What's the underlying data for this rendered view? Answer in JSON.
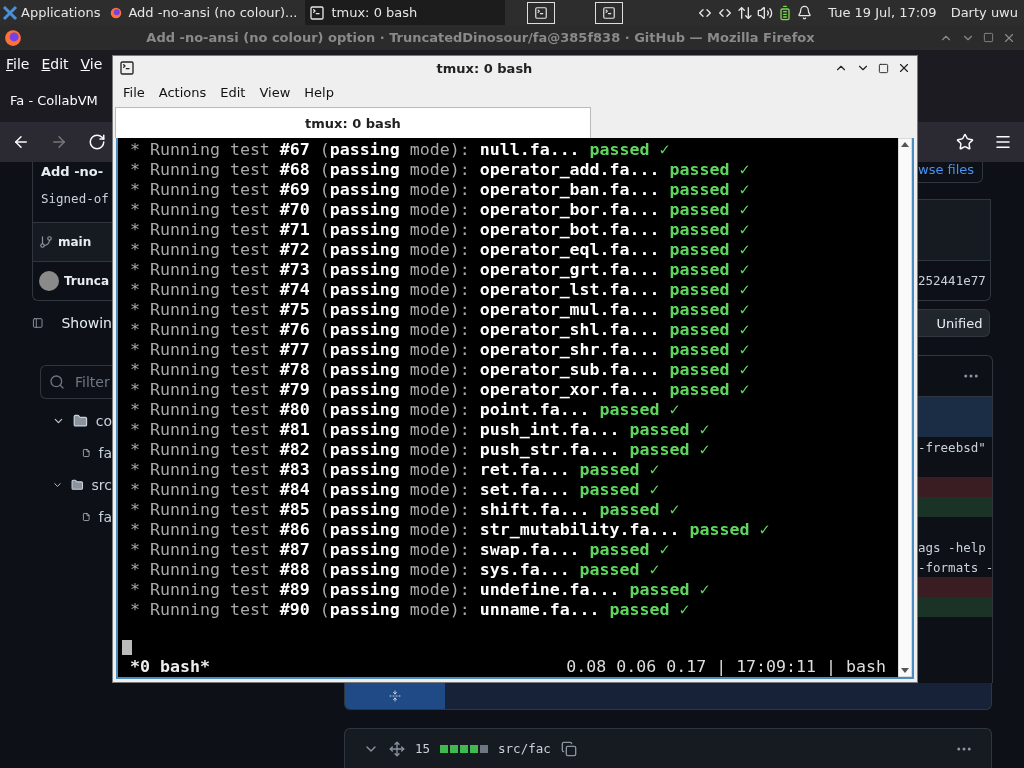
{
  "taskbar": {
    "apps_menu": "Applications",
    "tasks": [
      {
        "label": "Add -no-ansi (no colour)...",
        "kind": "browser",
        "selected": false
      },
      {
        "label": "tmux: 0 bash",
        "kind": "terminal",
        "selected": true
      }
    ],
    "clock": "Tue 19 Jul, 17:09",
    "user": "Darty uwu"
  },
  "browser": {
    "title": "Add -no-ansi (no colour) option · TruncatedDinosour/fa@385f838 · GitHub — Mozilla Firefox",
    "menu": [
      "File",
      "Edit",
      "Vie"
    ],
    "tab": "Fa - CollabVM"
  },
  "page": {
    "commit_title": "Add -no-",
    "signoff": "Signed-of",
    "branch": "main",
    "author": "Trunca",
    "showing": "Showin",
    "filter_placeholder": "Filter",
    "tree": [
      {
        "kind": "folder",
        "name": "co",
        "expanded": true,
        "children": [
          {
            "kind": "file",
            "name": "fa"
          }
        ]
      },
      {
        "kind": "folder",
        "name": "src",
        "expanded": true,
        "children": [
          {
            "kind": "file",
            "name": "fa"
          }
        ]
      }
    ],
    "browse": "wse files",
    "sha": "252441e77",
    "view_mode": "Unified",
    "diff_lines": [
      {
        "kind": "hunk"
      },
      {
        "kind": "context",
        "text": "-freebsd\""
      },
      {
        "kind": "context"
      },
      {
        "kind": "deletion"
      },
      {
        "kind": "addition"
      },
      {
        "kind": "context"
      },
      {
        "kind": "context",
        "text": "ags -help"
      },
      {
        "kind": "context",
        "text": "-formats -"
      },
      {
        "kind": "deletion"
      },
      {
        "kind": "addition"
      }
    ],
    "file_header": {
      "count": "15",
      "path": "src/fac",
      "diffstat": [
        {
          "color": "#3fb950"
        },
        {
          "color": "#3fb950"
        },
        {
          "color": "#3fb950"
        },
        {
          "color": "#3fb950"
        },
        {
          "color": "#6e7681"
        }
      ]
    }
  },
  "terminal": {
    "title": "tmux: 0 bash",
    "menu": [
      "File",
      "Actions",
      "Edit",
      "View",
      "Help"
    ],
    "tab": "tmux: 0 bash",
    "lines": [
      {
        "text": "* Running test **#67** (**passing** mode): **null.fa...**",
        "status": "passed ✓"
      },
      {
        "text": "* Running test **#68** (**passing** mode): **operator_add.fa...**",
        "status": "passed ✓"
      },
      {
        "text": "* Running test **#69** (**passing** mode): **operator_ban.fa...**",
        "status": "passed ✓"
      },
      {
        "text": "* Running test **#70** (**passing** mode): **operator_bor.fa...**",
        "status": "passed ✓"
      },
      {
        "text": "* Running test **#71** (**passing** mode): **operator_bot.fa...**",
        "status": "passed ✓"
      },
      {
        "text": "* Running test **#72** (**passing** mode): **operator_eql.fa...**",
        "status": "passed ✓"
      },
      {
        "text": "* Running test **#73** (**passing** mode): **operator_grt.fa...**",
        "status": "passed ✓"
      },
      {
        "text": "* Running test **#74** (**passing** mode): **operator_lst.fa...**",
        "status": "passed ✓"
      },
      {
        "text": "* Running test **#75** (**passing** mode): **operator_mul.fa...**",
        "status": "passed ✓"
      },
      {
        "text": "* Running test **#76** (**passing** mode): **operator_shl.fa...**",
        "status": "passed ✓"
      },
      {
        "text": "* Running test **#77** (**passing** mode): **operator_shr.fa...**",
        "status": "passed ✓"
      },
      {
        "text": "* Running test **#78** (**passing** mode): **operator_sub.fa...**",
        "status": "passed ✓"
      },
      {
        "text": "* Running test **#79** (**passing** mode): **operator_xor.fa...**",
        "status": "passed ✓"
      },
      {
        "text": "* Running test **#80** (**passing** mode): **point.fa...**",
        "status": "passed ✓"
      },
      {
        "text": "* Running test **#81** (**passing** mode): **push_int.fa...**",
        "status": "passed ✓"
      },
      {
        "text": "* Running test **#82** (**passing** mode): **push_str.fa...**",
        "status": "passed ✓"
      },
      {
        "text": "* Running test **#83** (**passing** mode): **ret.fa...**",
        "status": "passed ✓"
      },
      {
        "text": "* Running test **#84** (**passing** mode): **set.fa...**",
        "status": "passed ✓"
      },
      {
        "text": "* Running test **#85** (**passing** mode): **shift.fa...**",
        "status": "passed ✓"
      },
      {
        "text": "* Running test **#86** (**passing** mode): **str_mutability.fa...**",
        "status": "passed ✓"
      },
      {
        "text": "* Running test **#87** (**passing** mode): **swap.fa...**",
        "status": "passed ✓"
      },
      {
        "text": "* Running test **#88** (**passing** mode): **sys.fa...**",
        "status": "passed ✓"
      },
      {
        "text": "* Running test **#89** (**passing** mode): **undefine.fa...**",
        "status": "passed ✓"
      },
      {
        "text": "* Running test **#90** (**passing** mode): **unname.fa...**",
        "status": "passed ✓"
      }
    ],
    "status_left": "*0 bash*",
    "status_right": "0.08 0.06 0.17 | 17:09:11 | bash"
  }
}
